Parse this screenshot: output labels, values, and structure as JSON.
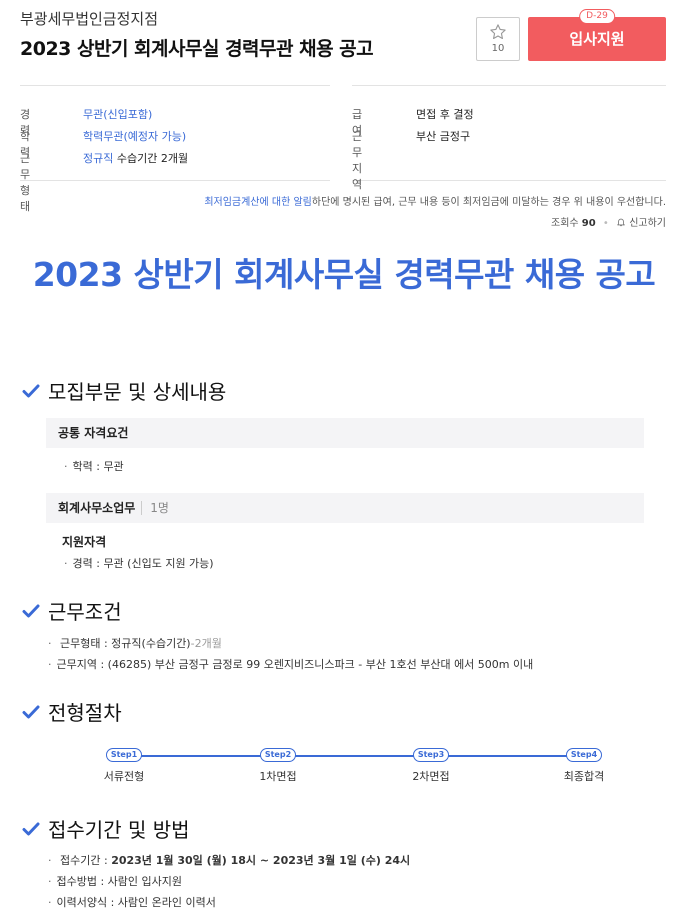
{
  "header": {
    "company": "부광세무법인금정지점",
    "title": "2023 상반기 회계사무실 경력무관 채용 공고",
    "star_count": "10",
    "apply_label": "입사지원",
    "dday": "D-29"
  },
  "summary": {
    "left": [
      {
        "label": "경력",
        "value": "무관(신입포함)"
      },
      {
        "label": "학력",
        "value": "학력무관(예정자 가능)"
      },
      {
        "label": "근무형태",
        "value": "정규직",
        "extra": "수습기간 2개월"
      }
    ],
    "right": [
      {
        "label": "급여",
        "value": "면접 후 결정"
      },
      {
        "label": "근무지역",
        "value": "부산 금정구"
      }
    ]
  },
  "notice": {
    "link": "최저임금계산에 대한 알림",
    "text": "하단에 명시된 급여, 근무 내용 등이 최저임금에 미달하는 경우 위 내용이 우선합니다."
  },
  "meta": {
    "views_label": "조회수",
    "views_value": "90",
    "report_label": "신고하기"
  },
  "body": {
    "big_title": "2023 상반기 회계사무실 경력무관 채용 공고",
    "section1": {
      "title": "모집부문 및 상세내용",
      "common_label": "공통 자격요건",
      "common_items": [
        "학력 : 무관"
      ],
      "dept_label": "회계사무소업무",
      "dept_count": "1명",
      "qual_label": "지원자격",
      "qual_items": [
        "경력 : 무관 (신입도 지원 가능)"
      ]
    },
    "section2": {
      "title": "근무조건",
      "type_prefix": "근무형태 : 정규직(수습기간)",
      "type_suffix": "-2개월",
      "area": "근무지역 : (46285) 부산 금정구 금정로 99 오렌지비즈니스파크 - 부산 1호선 부산대 에서 500m 이내"
    },
    "section3": {
      "title": "전형절차",
      "steps": [
        {
          "pill": "Step1",
          "label": "서류전형"
        },
        {
          "pill": "Step2",
          "label": "1차면접"
        },
        {
          "pill": "Step3",
          "label": "2차면접"
        },
        {
          "pill": "Step4",
          "label": "최종합격"
        }
      ]
    },
    "section4": {
      "title": "접수기간 및 방법",
      "period_label": "접수기간 : ",
      "period_value": "2023년 1월 30일 (월) 18시 ~ 2023년 3월 1일 (수) 24시",
      "method": "접수방법 : 사람인 입사지원",
      "form": "이력서양식 : 사람인 온라인 이력서"
    }
  },
  "colors": {
    "accent": "#3a6ad6",
    "apply": "#f25c5f"
  }
}
